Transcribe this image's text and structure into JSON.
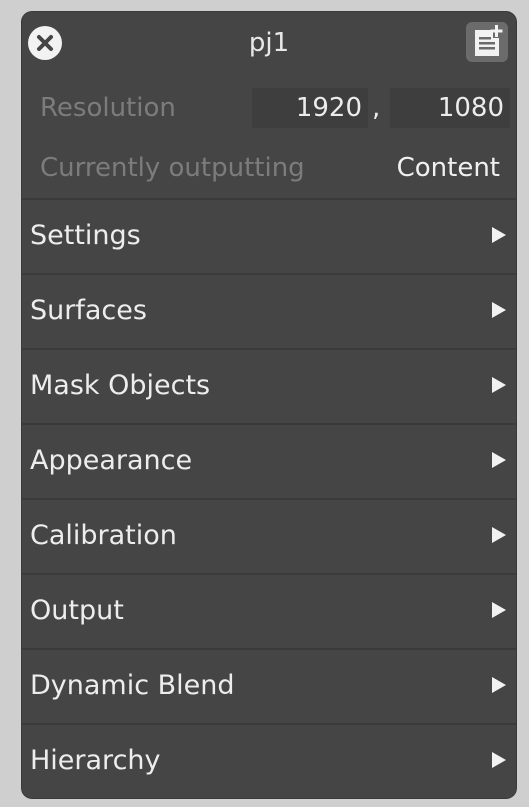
{
  "window": {
    "title": "pj1"
  },
  "resolution": {
    "label": "Resolution",
    "width": "1920",
    "separator": ",",
    "height": "1080"
  },
  "output_status": {
    "label": "Currently outputting",
    "value": "Content"
  },
  "menu": {
    "items": [
      {
        "label": "Settings"
      },
      {
        "label": "Surfaces"
      },
      {
        "label": "Mask Objects"
      },
      {
        "label": "Appearance"
      },
      {
        "label": "Calibration"
      },
      {
        "label": "Output"
      },
      {
        "label": "Dynamic Blend"
      },
      {
        "label": "Hierarchy"
      }
    ]
  },
  "colors": {
    "panel_bg": "#454545",
    "outer_bg": "#cfcfcf",
    "text": "#ededed",
    "muted_text": "#7c7c7c",
    "field_bg": "#3e3e3e"
  },
  "icons": {
    "close": "close-circle-icon",
    "notes": "notes-add-icon",
    "expand": "triangle-right-icon"
  }
}
